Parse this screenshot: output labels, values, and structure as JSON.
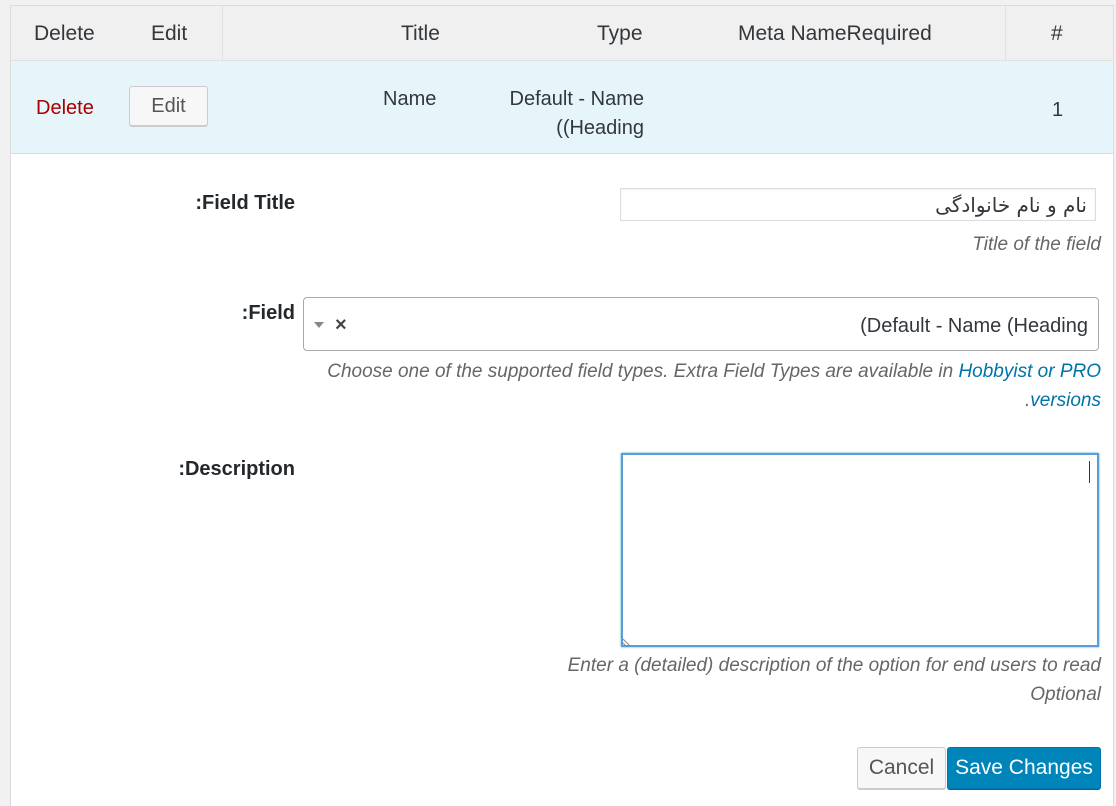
{
  "table": {
    "headers": {
      "delete": "Delete",
      "edit": "Edit",
      "title": "Title",
      "type": "Type",
      "meta_name_required": "Meta NameRequired",
      "number": "#"
    },
    "row": {
      "delete": "Delete",
      "edit": "Edit",
      "title": "Name",
      "type_line1": "Default - Name",
      "type_line2": "((Heading",
      "number": "1"
    }
  },
  "form": {
    "field_title": {
      "label": ":Field Title",
      "value": "نام و نام خانوادگی",
      "help": "Title of the field"
    },
    "field": {
      "label": ":Field",
      "selected": "(Default - Name (Heading",
      "clear": "×",
      "help_prefix": "Choose one of the supported field types. Extra Field Types are available in ",
      "help_link": "Hobbyist or PRO",
      "help_line2_link": "versions",
      "help_line2_suffix": "."
    },
    "description": {
      "label": ":Description",
      "value": "",
      "help_line1": "Enter a (detailed) description of the option for end users to read",
      "help_line2": "Optional"
    }
  },
  "buttons": {
    "cancel": "Cancel",
    "save": "Save Changes"
  },
  "colors": {
    "accent": "#0085ba",
    "link": "#0073aa",
    "delete": "#aa0000",
    "row_highlight": "#e5f5fa"
  }
}
